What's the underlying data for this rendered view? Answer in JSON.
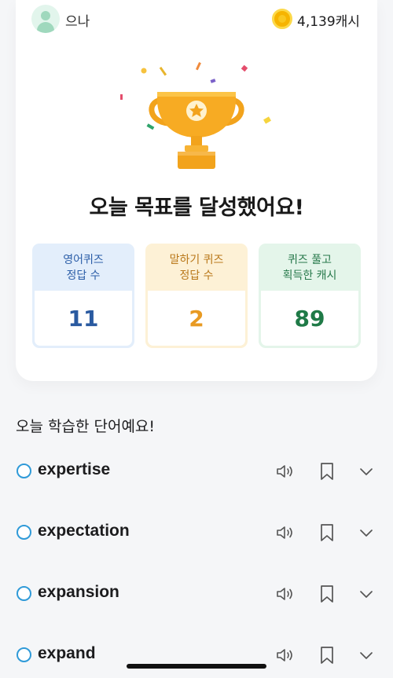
{
  "header": {
    "username": "으나",
    "cash": "4,139캐시",
    "avatar_icon": "user-avatar-icon",
    "coin_icon": "coin-icon"
  },
  "goal": {
    "title": "오늘 목표를 달성했어요!",
    "trophy_icon": "trophy-icon"
  },
  "stats": [
    {
      "label": "영어퀴즈\n정답 수",
      "value": "11",
      "color": "#2a5aa0"
    },
    {
      "label": "말하기 퀴즈\n정답 수",
      "value": "2",
      "color": "#e89a22"
    },
    {
      "label": "퀴즈 풀고\n획득한 캐시",
      "value": "89",
      "color": "#1f7a47"
    }
  ],
  "words_section": {
    "title": "오늘 학습한 단어예요!",
    "items": [
      {
        "word": "expertise"
      },
      {
        "word": "expectation"
      },
      {
        "word": "expansion"
      },
      {
        "word": "expand"
      }
    ],
    "icons": [
      "radio-icon",
      "speaker-icon",
      "bookmark-icon",
      "chevron-down-icon"
    ]
  },
  "colors": {
    "accent_blue": "#2f9ad8",
    "trophy_gold": "#f6a623"
  }
}
